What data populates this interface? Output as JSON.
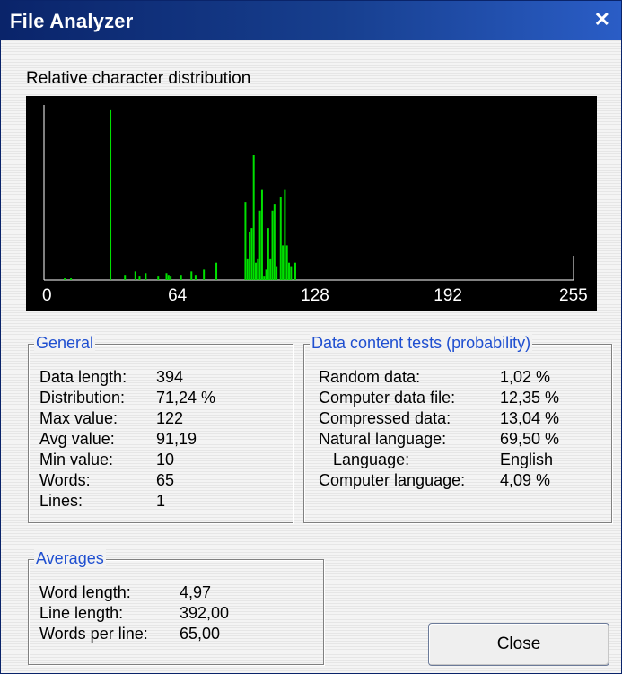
{
  "window": {
    "title": "File Analyzer"
  },
  "distribution": {
    "label": "Relative character distribution",
    "ticks": [
      "0",
      "64",
      "128",
      "192",
      "255"
    ]
  },
  "chart_data": {
    "type": "bar",
    "x_range": [
      0,
      255
    ],
    "ylim": [
      0,
      1
    ],
    "series_colors": {
      "whitespace": "#00e000",
      "lowercase": "#00e000"
    },
    "bars": [
      {
        "x": 10,
        "y": 0.01
      },
      {
        "x": 13,
        "y": 0.01
      },
      {
        "x": 32,
        "y": 0.98
      },
      {
        "x": 39,
        "y": 0.03
      },
      {
        "x": 44,
        "y": 0.05
      },
      {
        "x": 46,
        "y": 0.02
      },
      {
        "x": 49,
        "y": 0.04
      },
      {
        "x": 55,
        "y": 0.02
      },
      {
        "x": 59,
        "y": 0.04
      },
      {
        "x": 60,
        "y": 0.03
      },
      {
        "x": 61,
        "y": 0.02
      },
      {
        "x": 66,
        "y": 0.03
      },
      {
        "x": 71,
        "y": 0.05
      },
      {
        "x": 73,
        "y": 0.03
      },
      {
        "x": 77,
        "y": 0.06
      },
      {
        "x": 83,
        "y": 0.1
      },
      {
        "x": 97,
        "y": 0.45
      },
      {
        "x": 98,
        "y": 0.12
      },
      {
        "x": 99,
        "y": 0.28
      },
      {
        "x": 100,
        "y": 0.3
      },
      {
        "x": 101,
        "y": 0.72
      },
      {
        "x": 102,
        "y": 0.1
      },
      {
        "x": 103,
        "y": 0.12
      },
      {
        "x": 104,
        "y": 0.4
      },
      {
        "x": 105,
        "y": 0.52
      },
      {
        "x": 106,
        "y": 0.02
      },
      {
        "x": 107,
        "y": 0.06
      },
      {
        "x": 108,
        "y": 0.3
      },
      {
        "x": 109,
        "y": 0.12
      },
      {
        "x": 110,
        "y": 0.4
      },
      {
        "x": 111,
        "y": 0.44
      },
      {
        "x": 112,
        "y": 0.08
      },
      {
        "x": 114,
        "y": 0.48
      },
      {
        "x": 115,
        "y": 0.2
      },
      {
        "x": 116,
        "y": 0.52
      },
      {
        "x": 117,
        "y": 0.2
      },
      {
        "x": 118,
        "y": 0.1
      },
      {
        "x": 119,
        "y": 0.08
      },
      {
        "x": 121,
        "y": 0.1
      }
    ]
  },
  "general": {
    "title": "General",
    "rows": [
      {
        "key": "Data length:",
        "value": "394"
      },
      {
        "key": "Distribution:",
        "value": "71,24 %"
      },
      {
        "key": "Max value:",
        "value": "122"
      },
      {
        "key": "Avg value:",
        "value": "91,19"
      },
      {
        "key": "Min value:",
        "value": "10"
      },
      {
        "key": "Words:",
        "value": "65"
      },
      {
        "key": "Lines:",
        "value": "1"
      }
    ]
  },
  "tests": {
    "title": "Data content tests (probability)",
    "rows": [
      {
        "key": "Random data:",
        "value": "1,02 %"
      },
      {
        "key": "Computer data file:",
        "value": "12,35 %"
      },
      {
        "key": "Compressed data:",
        "value": "13,04 %"
      },
      {
        "key": "Natural language:",
        "value": "69,50 %"
      },
      {
        "key": "Language:",
        "value": "English"
      },
      {
        "key": "Computer language:",
        "value": "4,09 %"
      }
    ]
  },
  "averages": {
    "title": "Averages",
    "rows": [
      {
        "key": "Word length:",
        "value": "4,97"
      },
      {
        "key": "Line length:",
        "value": "392,00"
      },
      {
        "key": "Words per line:",
        "value": "65,00"
      }
    ]
  },
  "buttons": {
    "close": "Close"
  }
}
